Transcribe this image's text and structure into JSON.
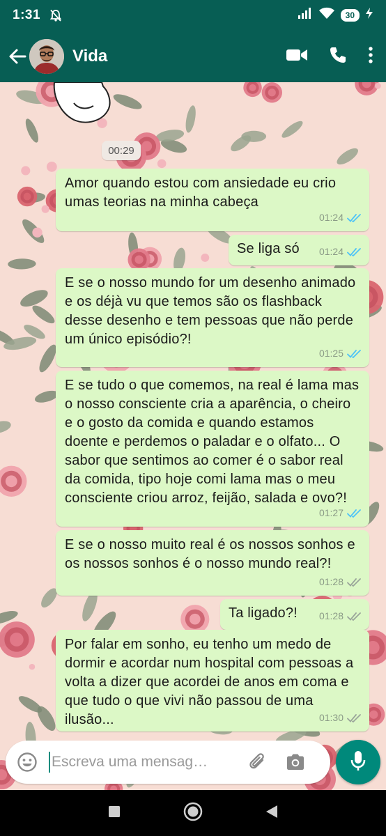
{
  "status_bar": {
    "time": "1:31",
    "battery": "30"
  },
  "header": {
    "contact_name": "Vida",
    "accent_color": "#075e54"
  },
  "chat": {
    "date_chip": "00:29",
    "messages": [
      {
        "text": "Amor quando estou com ansiedade eu crio umas teorias na minha cabeça",
        "time": "01:24",
        "status": "read"
      },
      {
        "text": "Se liga só",
        "time": "01:24",
        "status": "read"
      },
      {
        "text": "E se o nosso mundo for um desenho animado e os déjà vu que temos são os flashback desse desenho e tem pessoas que não perde um único episódio?!",
        "time": "01:25",
        "status": "read"
      },
      {
        "text": "E se tudo o que comemos, na real é lama mas o nosso consciente cria a aparência, o cheiro e o gosto da comida e quando estamos doente e perdemos o paladar e o olfato... O sabor que sentimos ao comer é o sabor real da comida, tipo hoje comi lama mas o meu consciente criou arroz, feijão, salada e ovo?!",
        "time": "01:27",
        "status": "read"
      },
      {
        "text": "E se o nosso muito real é os nossos sonhos e os nossos sonhos é o nosso mundo real?!",
        "time": "01:28",
        "status": "delivered"
      },
      {
        "text": "Ta ligado?!",
        "time": "01:28",
        "status": "delivered"
      },
      {
        "text": "Por falar em sonho, eu tenho um medo de dormir e acordar num hospital com pessoas a volta a dizer que acordei de anos em coma e que tudo o que vivi não passou de uma ilusão...",
        "time": "01:30",
        "status": "delivered"
      }
    ],
    "read_tick_color": "#4fc3f7",
    "delivered_tick_color": "#9aa59a",
    "bubble_color": "#dcf8c6"
  },
  "composer": {
    "placeholder": "Escreva uma mensag…",
    "mic_color": "#00897b"
  },
  "icons": [
    "no-notifications-icon",
    "signal-icon",
    "wifi-icon",
    "charging-icon",
    "back-arrow-icon",
    "video-call-icon",
    "voice-call-icon",
    "more-options-icon",
    "emoji-icon",
    "attach-icon",
    "camera-icon",
    "mic-icon",
    "nav-recents-icon",
    "nav-home-icon",
    "nav-back-icon"
  ]
}
